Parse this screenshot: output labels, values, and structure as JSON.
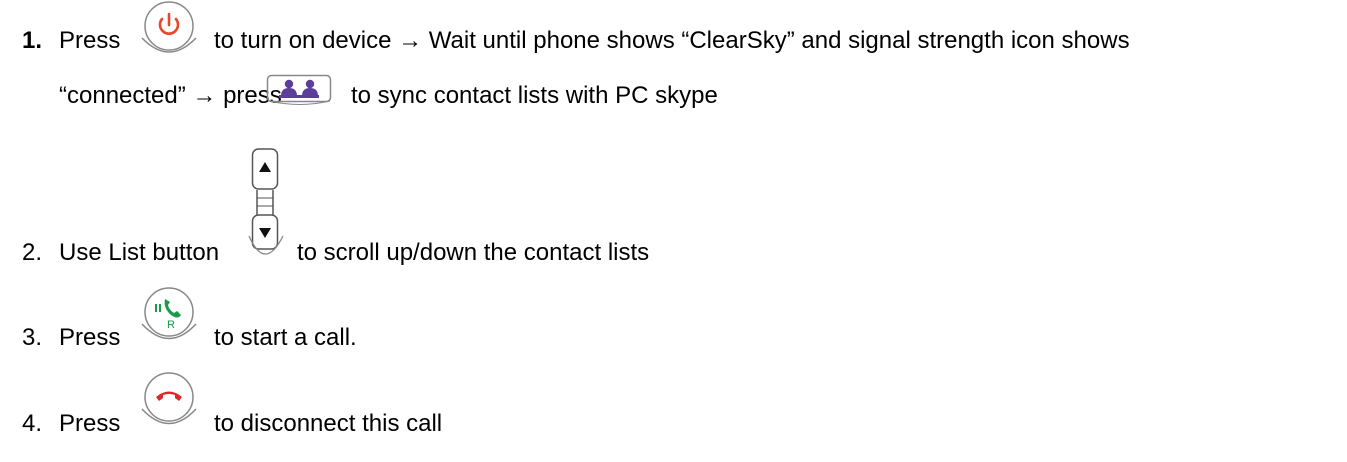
{
  "steps": [
    {
      "number": "1.",
      "line1_press": "Press",
      "line1_text": "to turn on device → Wait until phone shows “ClearSky” and signal strength icon shows",
      "line2_text": "“connected” → press",
      "line2_tail": "to sync contact lists with PC skype",
      "icons": [
        "power-button-icon",
        "contacts-sync-button-icon"
      ]
    },
    {
      "number": "2.",
      "text": "Use List button",
      "tail": "to scroll up/down the contact lists",
      "icons": [
        "list-up-down-button-icon"
      ]
    },
    {
      "number": "3.",
      "text": "Press",
      "tail": "to start a call.",
      "icons": [
        "call-button-icon"
      ],
      "icon_glyph_label": "R"
    },
    {
      "number": "4.",
      "text": "Press",
      "tail": "to disconnect this call",
      "icons": [
        "end-call-button-icon"
      ]
    }
  ],
  "colors": {
    "power": "#e8482a",
    "call": "#1a9a4a",
    "end_call": "#e0262b",
    "contacts": "#5a3e9a"
  }
}
